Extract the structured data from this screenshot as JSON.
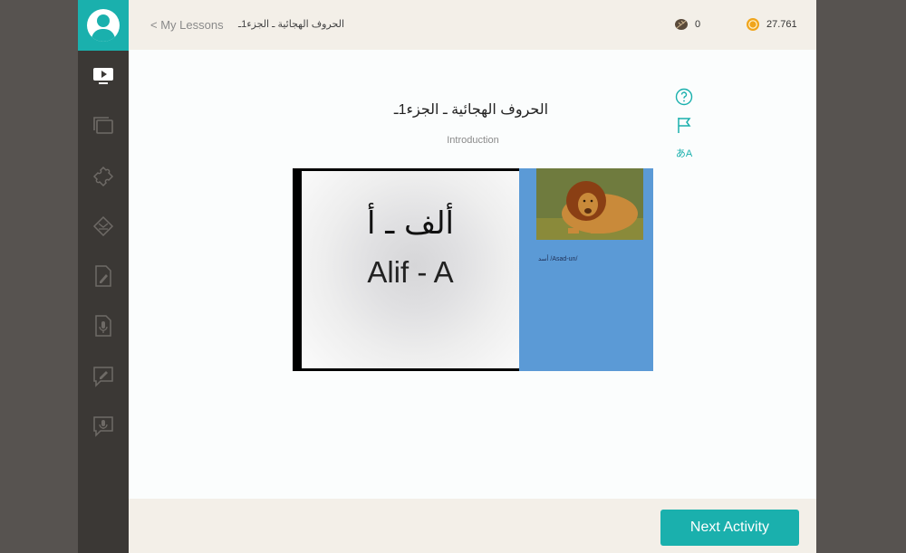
{
  "sidebar": {
    "items": [
      {
        "name": "video-lesson",
        "icon": "tv-icon",
        "active": true
      },
      {
        "name": "flashcards",
        "icon": "cards-icon",
        "active": false
      },
      {
        "name": "puzzle",
        "icon": "puzzle-icon",
        "active": false
      },
      {
        "name": "matching",
        "icon": "shuffle-icon",
        "active": false
      },
      {
        "name": "writing",
        "icon": "document-pencil-icon",
        "active": false
      },
      {
        "name": "listening",
        "icon": "document-microphone-icon",
        "active": false
      },
      {
        "name": "speaking-write",
        "icon": "speech-pencil-icon",
        "active": false
      },
      {
        "name": "speaking-record",
        "icon": "speech-microphone-icon",
        "active": false
      }
    ]
  },
  "header": {
    "back_label": "< My Lessons",
    "breadcrumb_title": "الحروف الهجائية ـ الجزء1ـ",
    "wheat_count": "0",
    "coin_count": "27.761"
  },
  "lesson": {
    "title": "الحروف الهجائية ـ الجزء1ـ",
    "subtitle": "Introduction"
  },
  "slide": {
    "arabic_text": "ألف ـ أ",
    "latin_text": "Alif - A"
  },
  "vocab": {
    "caption": "أسد  /Asad-un/",
    "image": "lion-photo"
  },
  "tools": {
    "help_icon": "help-icon",
    "flag_icon": "flag-icon",
    "translate_icon": "translate-icon",
    "translate_glyph": "あA"
  },
  "footer": {
    "next_label": "Next Activity"
  },
  "colors": {
    "accent": "#1ab0ad",
    "sidebar": "#3b3835",
    "panel_blue": "#5b9ad6",
    "bar_beige": "#f3efe8"
  }
}
